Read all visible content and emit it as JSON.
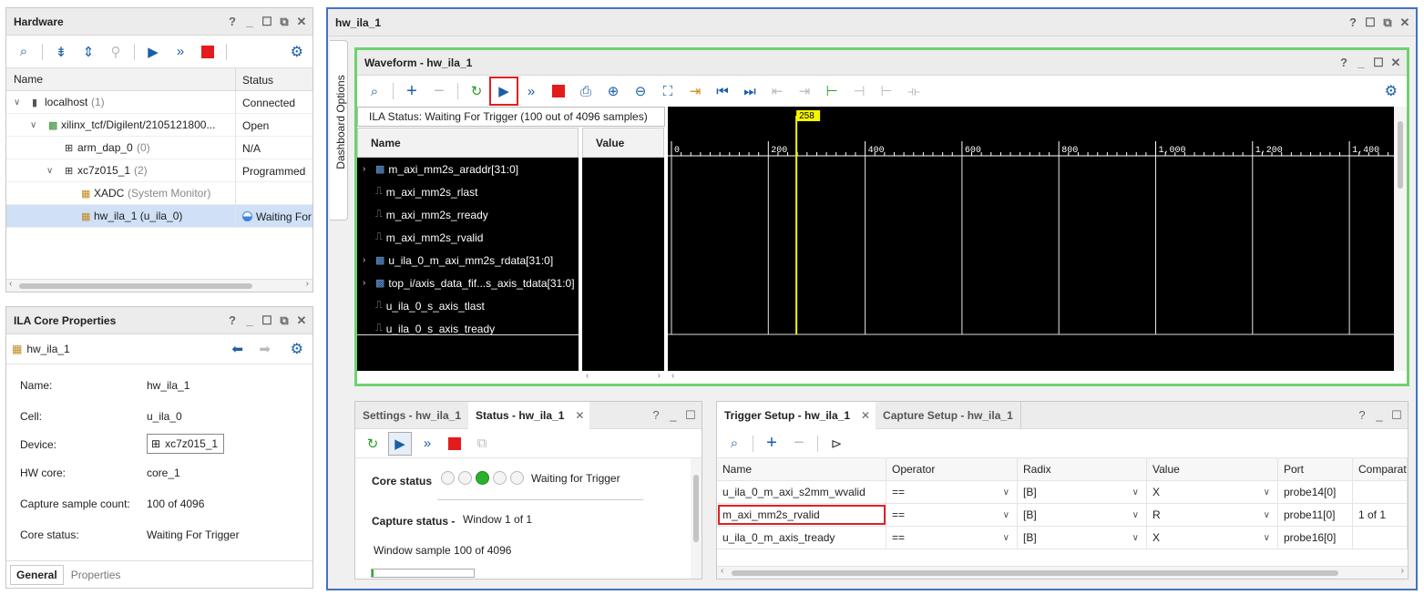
{
  "hardware": {
    "title": "Hardware",
    "columns": [
      "Name",
      "Status"
    ],
    "rows": [
      {
        "chevron": "∨",
        "name": "localhost",
        "extra": "(1)",
        "status": "Connected"
      },
      {
        "chevron": "∨",
        "name": "xilinx_tcf/Digilent/2105121800...",
        "extra": "",
        "status": "Open"
      },
      {
        "chevron": "",
        "name": "arm_dap_0",
        "extra": "(0)",
        "status": "N/A"
      },
      {
        "chevron": "∨",
        "name": "xc7z015_1",
        "extra": "(2)",
        "status": "Programmed"
      },
      {
        "chevron": "",
        "name": "XADC",
        "extra": "(System Monitor)",
        "status": ""
      },
      {
        "chevron": "",
        "name": "hw_ila_1 (u_ila_0)",
        "extra": "",
        "status": "Waiting For"
      }
    ]
  },
  "props": {
    "title": "ILA Core Properties",
    "object": "hw_ila_1",
    "fields": [
      {
        "label": "Name:",
        "value": "hw_ila_1"
      },
      {
        "label": "Cell:",
        "value": "u_ila_0"
      },
      {
        "label": "Device:",
        "value": "xc7z015_1"
      },
      {
        "label": "HW core:",
        "value": "core_1"
      },
      {
        "label": "Capture sample count:",
        "value": "100 of 4096"
      },
      {
        "label": "Core status:",
        "value": "Waiting For Trigger"
      }
    ],
    "tabs": [
      "General",
      "Properties"
    ]
  },
  "main": {
    "title": "hw_ila_1",
    "side_tab": "Dashboard Options"
  },
  "waveform": {
    "title": "Waveform - hw_ila_1",
    "ila_status": "ILA Status: Waiting For Trigger (100 out of 4096 samples)",
    "name_header": "Name",
    "value_header": "Value",
    "signals": [
      {
        "expand": true,
        "name": "m_axi_mm2s_araddr[31:0]"
      },
      {
        "expand": false,
        "name": "m_axi_mm2s_rlast"
      },
      {
        "expand": false,
        "name": "m_axi_mm2s_rready"
      },
      {
        "expand": false,
        "name": "m_axi_mm2s_rvalid"
      },
      {
        "expand": true,
        "name": "u_ila_0_m_axi_mm2s_rdata[31:0]"
      },
      {
        "expand": true,
        "name": "top_i/axis_data_fif...s_axis_tdata[31:0]"
      },
      {
        "expand": false,
        "name": "u_ila_0_s_axis_tlast"
      },
      {
        "expand": false,
        "name": "u_ila_0_s_axis_tready"
      }
    ],
    "cursor_label": "258",
    "ticks": [
      "0",
      "200",
      "400",
      "600",
      "800",
      "1,000",
      "1,200",
      "1,400"
    ]
  },
  "status_panel": {
    "tabs": [
      "Settings - hw_ila_1",
      "Status - hw_ila_1"
    ],
    "core_status_label": "Core status",
    "core_status_text": "Waiting for Trigger",
    "capture_label": "Capture status -",
    "capture_value": "Window 1 of 1",
    "window_sample": "Window sample 100 of 4096"
  },
  "trigger": {
    "tabs": [
      "Trigger Setup - hw_ila_1",
      "Capture Setup - hw_ila_1"
    ],
    "columns": [
      "Name",
      "Operator",
      "Radix",
      "Value",
      "Port",
      "Comparat"
    ],
    "rows": [
      {
        "name": "u_ila_0_m_axi_s2mm_wvalid",
        "op": "==",
        "radix": "[B]",
        "value": "X",
        "port": "probe14[0]",
        "comp": ""
      },
      {
        "name": "m_axi_mm2s_rvalid",
        "op": "==",
        "radix": "[B]",
        "value": "R",
        "port": "probe11[0]",
        "comp": "1 of 1"
      },
      {
        "name": "u_ila_0_m_axis_tready",
        "op": "==",
        "radix": "[B]",
        "value": "X",
        "port": "probe16[0]",
        "comp": ""
      }
    ]
  },
  "colors": {
    "accent": "#1a5ea8",
    "waveform_border": "#6fd26f",
    "highlight": "#e02020",
    "cursor": "#f5f500"
  }
}
